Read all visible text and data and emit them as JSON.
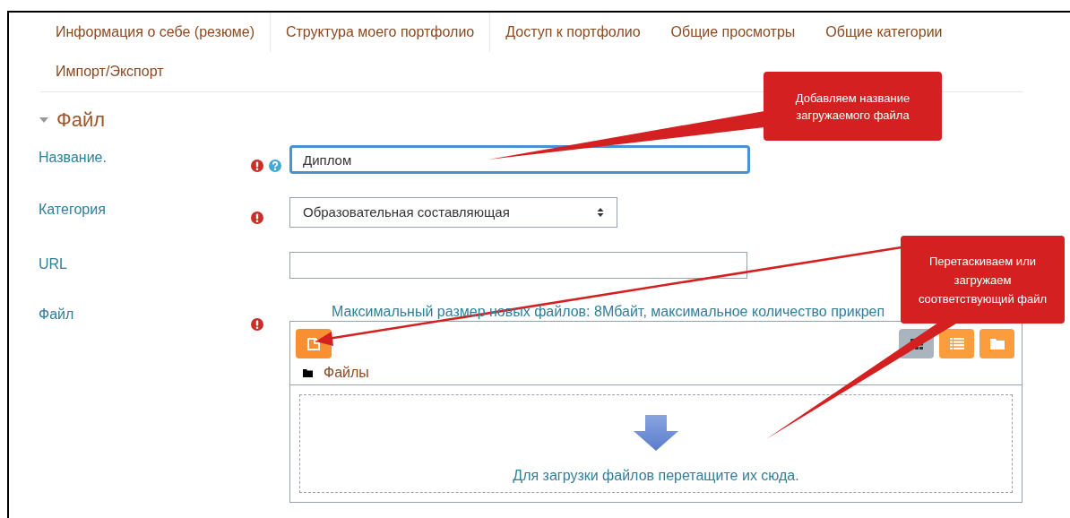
{
  "tabs": [
    {
      "label": "Информация о себе (резюме)"
    },
    {
      "label": "Структура моего портфолио"
    },
    {
      "label": "Доступ к портфолио"
    },
    {
      "label": "Общие просмотры"
    },
    {
      "label": "Общие категории"
    },
    {
      "label": "Импорт/Экспорт"
    }
  ],
  "section": {
    "title": "Файл",
    "expanded": true
  },
  "fields": [
    {
      "kind": "text",
      "label": "Название.",
      "required": true,
      "help": true,
      "value": "Диплом",
      "focused": true
    },
    {
      "kind": "select",
      "label": "Категория",
      "required": true,
      "value": "Образовательная составляющая"
    },
    {
      "kind": "text",
      "label": "URL",
      "required": false,
      "focused": false
    },
    {
      "kind": "file",
      "label": "Файл",
      "required": true,
      "limits": "Максимальный размер новых файлов: 8Мбайт, максимальное количество прикреп",
      "path": "Файлы",
      "drop_hint": "Для загрузки файлов перетащите их сюда.",
      "view_modes": [
        {
          "kind": "icons",
          "selected": true
        },
        {
          "kind": "list",
          "selected": false
        },
        {
          "kind": "tree",
          "selected": false
        }
      ]
    }
  ],
  "callouts": [
    {
      "text": "Добавляем название загружаемого файла"
    },
    {
      "text": "Перетаскиваем или загружаем соответствующий файл"
    }
  ]
}
